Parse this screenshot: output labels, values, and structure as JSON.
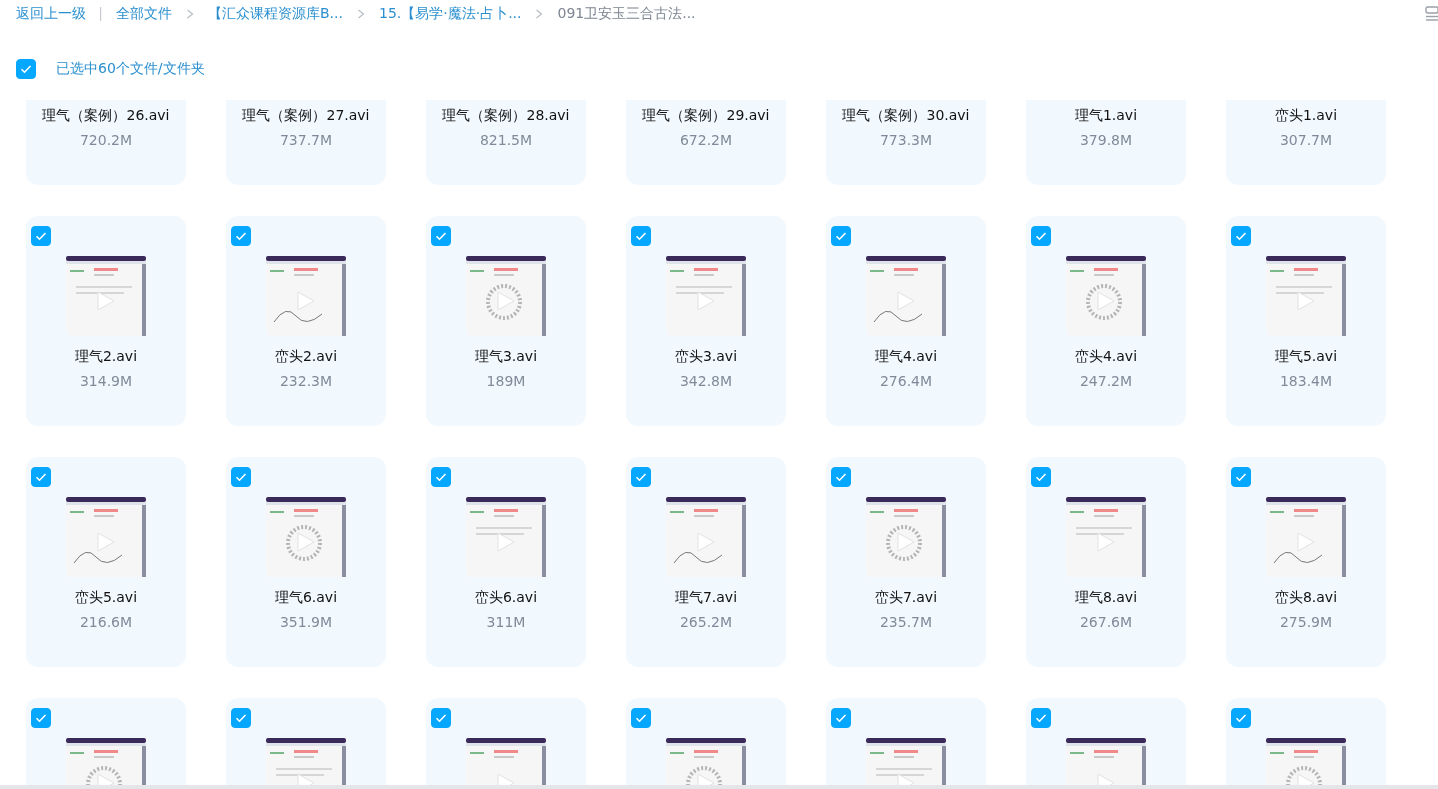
{
  "breadcrumb": {
    "back": "返回上一级",
    "items": [
      {
        "label": "全部文件",
        "current": false
      },
      {
        "label": "【汇众课程资源库B...",
        "current": false
      },
      {
        "label": "15.【易学·魔法·占卜...",
        "current": false
      },
      {
        "label": "091卫安玉三合古法...",
        "current": true
      }
    ]
  },
  "selection": {
    "checked": true,
    "label": "已选中60个文件/文件夹"
  },
  "file_rows": [
    [
      {
        "name": "理气（案例）26.avi",
        "size": "720.2M"
      },
      {
        "name": "理气（案例）27.avi",
        "size": "737.7M"
      },
      {
        "name": "理气（案例）28.avi",
        "size": "821.5M"
      },
      {
        "name": "理气（案例）29.avi",
        "size": "672.2M"
      },
      {
        "name": "理气（案例）30.avi",
        "size": "773.3M"
      },
      {
        "name": "理气1.avi",
        "size": "379.8M"
      },
      {
        "name": "峦头1.avi",
        "size": "307.7M"
      }
    ],
    [
      {
        "name": "理气2.avi",
        "size": "314.9M",
        "selected": true
      },
      {
        "name": "峦头2.avi",
        "size": "232.3M",
        "selected": true
      },
      {
        "name": "理气3.avi",
        "size": "189M",
        "selected": true
      },
      {
        "name": "峦头3.avi",
        "size": "342.8M",
        "selected": true
      },
      {
        "name": "理气4.avi",
        "size": "276.4M",
        "selected": true
      },
      {
        "name": "峦头4.avi",
        "size": "247.2M",
        "selected": true
      },
      {
        "name": "理气5.avi",
        "size": "183.4M",
        "selected": true
      }
    ],
    [
      {
        "name": "峦头5.avi",
        "size": "216.6M",
        "selected": true
      },
      {
        "name": "理气6.avi",
        "size": "351.9M",
        "selected": true
      },
      {
        "name": "峦头6.avi",
        "size": "311M",
        "selected": true
      },
      {
        "name": "理气7.avi",
        "size": "265.2M",
        "selected": true
      },
      {
        "name": "峦头7.avi",
        "size": "235.7M",
        "selected": true
      },
      {
        "name": "理气8.avi",
        "size": "267.6M",
        "selected": true
      },
      {
        "name": "峦头8.avi",
        "size": "275.9M",
        "selected": true
      }
    ],
    [
      {
        "selected": true
      },
      {
        "selected": true
      },
      {
        "selected": true
      },
      {
        "selected": true
      },
      {
        "selected": true
      },
      {
        "selected": true
      },
      {
        "selected": true
      }
    ]
  ]
}
